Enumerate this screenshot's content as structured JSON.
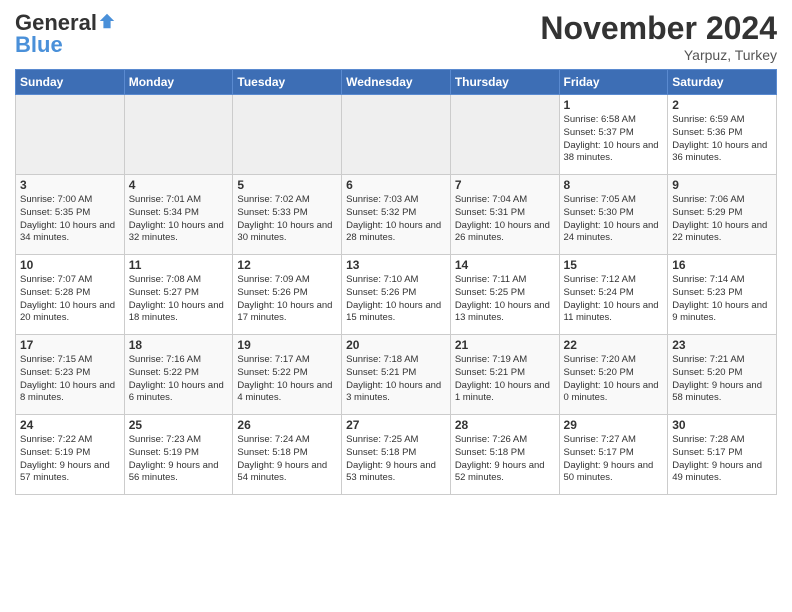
{
  "header": {
    "logo_general": "General",
    "logo_blue": "Blue",
    "month_title": "November 2024",
    "location": "Yarpuz, Turkey"
  },
  "days_of_week": [
    "Sunday",
    "Monday",
    "Tuesday",
    "Wednesday",
    "Thursday",
    "Friday",
    "Saturday"
  ],
  "weeks": [
    {
      "days": [
        {
          "empty": true
        },
        {
          "empty": true
        },
        {
          "empty": true
        },
        {
          "empty": true
        },
        {
          "empty": true
        },
        {
          "number": "1",
          "sunrise": "Sunrise: 6:58 AM",
          "sunset": "Sunset: 5:37 PM",
          "daylight": "Daylight: 10 hours and 38 minutes."
        },
        {
          "number": "2",
          "sunrise": "Sunrise: 6:59 AM",
          "sunset": "Sunset: 5:36 PM",
          "daylight": "Daylight: 10 hours and 36 minutes."
        }
      ]
    },
    {
      "days": [
        {
          "number": "3",
          "sunrise": "Sunrise: 7:00 AM",
          "sunset": "Sunset: 5:35 PM",
          "daylight": "Daylight: 10 hours and 34 minutes."
        },
        {
          "number": "4",
          "sunrise": "Sunrise: 7:01 AM",
          "sunset": "Sunset: 5:34 PM",
          "daylight": "Daylight: 10 hours and 32 minutes."
        },
        {
          "number": "5",
          "sunrise": "Sunrise: 7:02 AM",
          "sunset": "Sunset: 5:33 PM",
          "daylight": "Daylight: 10 hours and 30 minutes."
        },
        {
          "number": "6",
          "sunrise": "Sunrise: 7:03 AM",
          "sunset": "Sunset: 5:32 PM",
          "daylight": "Daylight: 10 hours and 28 minutes."
        },
        {
          "number": "7",
          "sunrise": "Sunrise: 7:04 AM",
          "sunset": "Sunset: 5:31 PM",
          "daylight": "Daylight: 10 hours and 26 minutes."
        },
        {
          "number": "8",
          "sunrise": "Sunrise: 7:05 AM",
          "sunset": "Sunset: 5:30 PM",
          "daylight": "Daylight: 10 hours and 24 minutes."
        },
        {
          "number": "9",
          "sunrise": "Sunrise: 7:06 AM",
          "sunset": "Sunset: 5:29 PM",
          "daylight": "Daylight: 10 hours and 22 minutes."
        }
      ]
    },
    {
      "days": [
        {
          "number": "10",
          "sunrise": "Sunrise: 7:07 AM",
          "sunset": "Sunset: 5:28 PM",
          "daylight": "Daylight: 10 hours and 20 minutes."
        },
        {
          "number": "11",
          "sunrise": "Sunrise: 7:08 AM",
          "sunset": "Sunset: 5:27 PM",
          "daylight": "Daylight: 10 hours and 18 minutes."
        },
        {
          "number": "12",
          "sunrise": "Sunrise: 7:09 AM",
          "sunset": "Sunset: 5:26 PM",
          "daylight": "Daylight: 10 hours and 17 minutes."
        },
        {
          "number": "13",
          "sunrise": "Sunrise: 7:10 AM",
          "sunset": "Sunset: 5:26 PM",
          "daylight": "Daylight: 10 hours and 15 minutes."
        },
        {
          "number": "14",
          "sunrise": "Sunrise: 7:11 AM",
          "sunset": "Sunset: 5:25 PM",
          "daylight": "Daylight: 10 hours and 13 minutes."
        },
        {
          "number": "15",
          "sunrise": "Sunrise: 7:12 AM",
          "sunset": "Sunset: 5:24 PM",
          "daylight": "Daylight: 10 hours and 11 minutes."
        },
        {
          "number": "16",
          "sunrise": "Sunrise: 7:14 AM",
          "sunset": "Sunset: 5:23 PM",
          "daylight": "Daylight: 10 hours and 9 minutes."
        }
      ]
    },
    {
      "days": [
        {
          "number": "17",
          "sunrise": "Sunrise: 7:15 AM",
          "sunset": "Sunset: 5:23 PM",
          "daylight": "Daylight: 10 hours and 8 minutes."
        },
        {
          "number": "18",
          "sunrise": "Sunrise: 7:16 AM",
          "sunset": "Sunset: 5:22 PM",
          "daylight": "Daylight: 10 hours and 6 minutes."
        },
        {
          "number": "19",
          "sunrise": "Sunrise: 7:17 AM",
          "sunset": "Sunset: 5:22 PM",
          "daylight": "Daylight: 10 hours and 4 minutes."
        },
        {
          "number": "20",
          "sunrise": "Sunrise: 7:18 AM",
          "sunset": "Sunset: 5:21 PM",
          "daylight": "Daylight: 10 hours and 3 minutes."
        },
        {
          "number": "21",
          "sunrise": "Sunrise: 7:19 AM",
          "sunset": "Sunset: 5:21 PM",
          "daylight": "Daylight: 10 hours and 1 minute."
        },
        {
          "number": "22",
          "sunrise": "Sunrise: 7:20 AM",
          "sunset": "Sunset: 5:20 PM",
          "daylight": "Daylight: 10 hours and 0 minutes."
        },
        {
          "number": "23",
          "sunrise": "Sunrise: 7:21 AM",
          "sunset": "Sunset: 5:20 PM",
          "daylight": "Daylight: 9 hours and 58 minutes."
        }
      ]
    },
    {
      "days": [
        {
          "number": "24",
          "sunrise": "Sunrise: 7:22 AM",
          "sunset": "Sunset: 5:19 PM",
          "daylight": "Daylight: 9 hours and 57 minutes."
        },
        {
          "number": "25",
          "sunrise": "Sunrise: 7:23 AM",
          "sunset": "Sunset: 5:19 PM",
          "daylight": "Daylight: 9 hours and 56 minutes."
        },
        {
          "number": "26",
          "sunrise": "Sunrise: 7:24 AM",
          "sunset": "Sunset: 5:18 PM",
          "daylight": "Daylight: 9 hours and 54 minutes."
        },
        {
          "number": "27",
          "sunrise": "Sunrise: 7:25 AM",
          "sunset": "Sunset: 5:18 PM",
          "daylight": "Daylight: 9 hours and 53 minutes."
        },
        {
          "number": "28",
          "sunrise": "Sunrise: 7:26 AM",
          "sunset": "Sunset: 5:18 PM",
          "daylight": "Daylight: 9 hours and 52 minutes."
        },
        {
          "number": "29",
          "sunrise": "Sunrise: 7:27 AM",
          "sunset": "Sunset: 5:17 PM",
          "daylight": "Daylight: 9 hours and 50 minutes."
        },
        {
          "number": "30",
          "sunrise": "Sunrise: 7:28 AM",
          "sunset": "Sunset: 5:17 PM",
          "daylight": "Daylight: 9 hours and 49 minutes."
        }
      ]
    }
  ]
}
